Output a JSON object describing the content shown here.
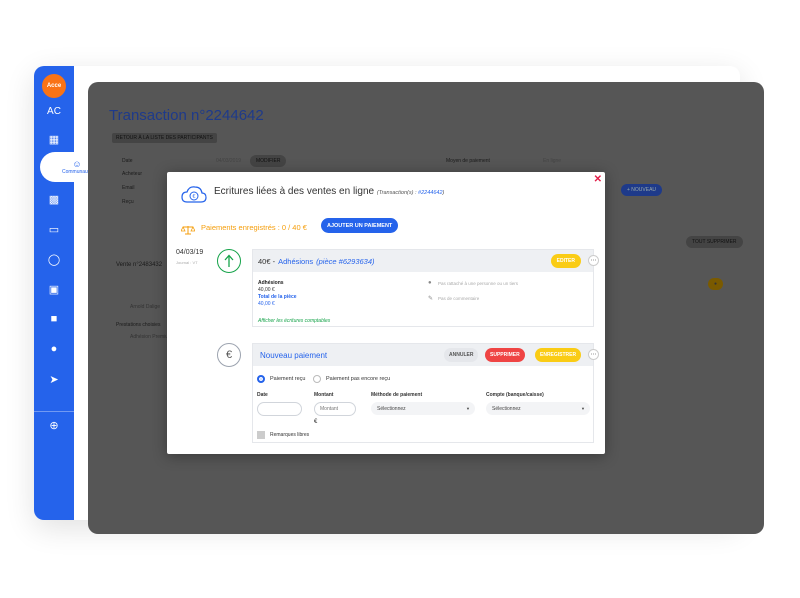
{
  "sidebar": {
    "brand": "Acce",
    "initials": "AC",
    "active_label": "Communauté"
  },
  "overlay": {
    "title": "Transaction n°2244642",
    "back_label": "RETOUR À LA LISTE DES PARTICIPANTS",
    "field_date": "Date",
    "field_buyer": "Acheteur",
    "field_email": "Email",
    "field_receipt": "Reçu",
    "date_value": "04/03/2019",
    "modify_label": "MODIFIER",
    "payment_method_label": "Moyen de paiement",
    "payment_method_value": "En ligne",
    "new_label": "+ NOUVEAU",
    "delete_all_label": "TOUT SUPPRIMER",
    "sale_label": "Vente n°2483432",
    "buyer_name": "Arnold Dalige",
    "services_label": "Prestations choisies",
    "adhesion_item": "Adhésion Premium"
  },
  "modal": {
    "title": "Ecritures liées à des ventes en ligne",
    "transactions_label": "(Transaction(s) : ",
    "transaction_ref": "#2244642",
    "transactions_close": ")",
    "paid_status": "Paiements enregistrés : 0 / 40 €",
    "add_payment_label": "AJOUTER UN PAIEMENT",
    "entry": {
      "date": "04/03/19",
      "date_sub": "Journal : VT",
      "amount": "40€ -",
      "category": "Adhésions",
      "ref": "(pièce #6293634)",
      "edit_label": "EDITER",
      "line_label": "Adhésions",
      "line_amount": "40,00 €",
      "total_label": "Total de la pièce",
      "total_amount": "40,00 €",
      "person_placeholder": "Pas rattaché à une personne ou un tiers",
      "comment_placeholder": "Pas de commentaire",
      "show_entries_link": "Afficher les écritures comptables"
    },
    "new_payment": {
      "title": "Nouveau paiement",
      "cancel_label": "ANNULER",
      "delete_label": "SUPPRIMER",
      "save_label": "ENREGISTRER",
      "radio_received": "Paiement reçu",
      "radio_not_received": "Paiement pas encore reçu",
      "date_label": "Date",
      "amount_label": "Montant",
      "amount_placeholder": "Montant",
      "currency": "€",
      "method_label": "Méthode de paiement",
      "method_value": "Sélectionnez",
      "account_label": "Compte (banque/caisse)",
      "account_value": "Sélectionnez",
      "remarks_label": "Remarques libres"
    }
  },
  "colors": {
    "primary": "#2563eb",
    "warning": "#facc15",
    "danger": "#ef4444",
    "success": "#16a34a",
    "overlay": "#565656"
  }
}
